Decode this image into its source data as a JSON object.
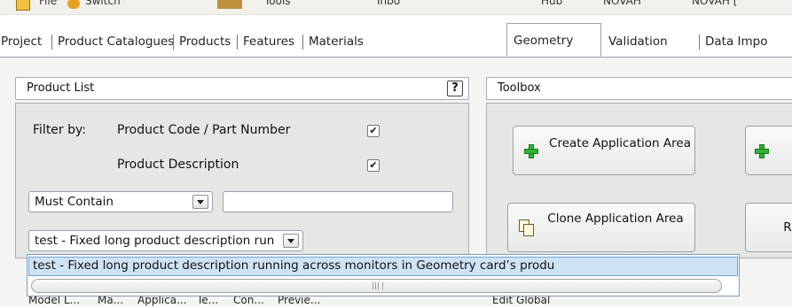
{
  "toolbar": {
    "items": [
      "File",
      "Switch",
      "Tools",
      "Inbo",
      "Hub",
      "NOVAH",
      "NOVAH ["
    ]
  },
  "tabs": [
    {
      "label": "Project"
    },
    {
      "label": "Product Catalogues"
    },
    {
      "label": "Products"
    },
    {
      "label": "Features"
    },
    {
      "label": "Materials"
    },
    {
      "label": "Geometry",
      "active": true
    },
    {
      "label": "Validation"
    },
    {
      "label": "Data Impo"
    }
  ],
  "product_list": {
    "title": "Product List",
    "help_label": "?",
    "filter_by_label": "Filter by:",
    "filters": [
      {
        "label": "Product Code / Part Number",
        "checked": true
      },
      {
        "label": "Product Description",
        "checked": true
      }
    ],
    "match_mode": "Must Contain",
    "filter_text": "",
    "selected_product": "test - Fixed long product description running acr",
    "dropdown_options": [
      "test - Fixed long product description running across monitors in Geometry card’s produ"
    ]
  },
  "bottom_tabs": [
    "Models",
    "L...",
    "Ma...",
    "Applica...",
    "Te...",
    "Con...",
    "Previe..."
  ],
  "toolbox": {
    "title": "Toolbox",
    "create_button": "Create Application Area",
    "clone_button": "Clone Application Area",
    "partial_button": "R",
    "bottom_label": "Edit Global"
  }
}
